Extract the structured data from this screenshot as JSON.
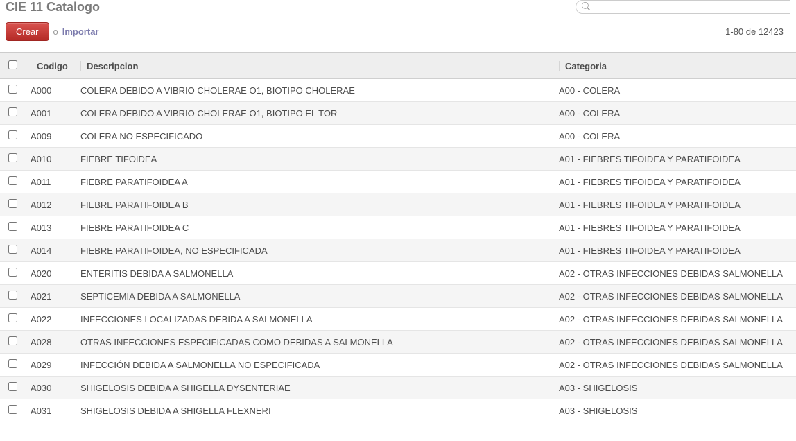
{
  "header": {
    "title": "CIE 11 Catalogo",
    "search_placeholder": ""
  },
  "toolbar": {
    "create_label": "Crear",
    "or_label": "o",
    "import_label": "Importar",
    "pagination": "1-80 de 12423"
  },
  "table": {
    "columns": {
      "codigo": "Codigo",
      "descripcion": "Descripcion",
      "categoria": "Categoria"
    },
    "rows": [
      {
        "codigo": "A000",
        "descripcion": "COLERA DEBIDO A VIBRIO CHOLERAE O1, BIOTIPO CHOLERAE",
        "categoria": "A00 - COLERA"
      },
      {
        "codigo": "A001",
        "descripcion": "COLERA DEBIDO A VIBRIO CHOLERAE O1, BIOTIPO EL TOR",
        "categoria": "A00 - COLERA"
      },
      {
        "codigo": "A009",
        "descripcion": "COLERA NO ESPECIFICADO",
        "categoria": "A00 - COLERA"
      },
      {
        "codigo": "A010",
        "descripcion": "FIEBRE TIFOIDEA",
        "categoria": "A01 - FIEBRES TIFOIDEA Y PARATIFOIDEA"
      },
      {
        "codigo": "A011",
        "descripcion": "FIEBRE PARATIFOIDEA A",
        "categoria": "A01 - FIEBRES TIFOIDEA Y PARATIFOIDEA"
      },
      {
        "codigo": "A012",
        "descripcion": "FIEBRE PARATIFOIDEA B",
        "categoria": "A01 - FIEBRES TIFOIDEA Y PARATIFOIDEA"
      },
      {
        "codigo": "A013",
        "descripcion": "FIEBRE PARATIFOIDEA C",
        "categoria": "A01 - FIEBRES TIFOIDEA Y PARATIFOIDEA"
      },
      {
        "codigo": "A014",
        "descripcion": "FIEBRE PARATIFOIDEA, NO ESPECIFICADA",
        "categoria": "A01 - FIEBRES TIFOIDEA Y PARATIFOIDEA"
      },
      {
        "codigo": "A020",
        "descripcion": "ENTERITIS DEBIDA A SALMONELLA",
        "categoria": "A02 - OTRAS INFECCIONES DEBIDAS SALMONELLA"
      },
      {
        "codigo": "A021",
        "descripcion": "SEPTICEMIA DEBIDA A SALMONELLA",
        "categoria": "A02 - OTRAS INFECCIONES DEBIDAS SALMONELLA"
      },
      {
        "codigo": "A022",
        "descripcion": "INFECCIONES LOCALIZADAS DEBIDA A SALMONELLA",
        "categoria": "A02 - OTRAS INFECCIONES DEBIDAS SALMONELLA"
      },
      {
        "codigo": "A028",
        "descripcion": "OTRAS INFECCIONES ESPECIFICADAS COMO DEBIDAS A SALMONELLA",
        "categoria": "A02 - OTRAS INFECCIONES DEBIDAS SALMONELLA"
      },
      {
        "codigo": "A029",
        "descripcion": "INFECCIÓN DEBIDA A SALMONELLA NO ESPECIFICADA",
        "categoria": "A02 - OTRAS INFECCIONES DEBIDAS SALMONELLA"
      },
      {
        "codigo": "A030",
        "descripcion": "SHIGELOSIS DEBIDA A SHIGELLA DYSENTERIAE",
        "categoria": "A03 - SHIGELOSIS"
      },
      {
        "codigo": "A031",
        "descripcion": "SHIGELOSIS DEBIDA A SHIGELLA FLEXNERI",
        "categoria": "A03 - SHIGELOSIS"
      }
    ]
  }
}
